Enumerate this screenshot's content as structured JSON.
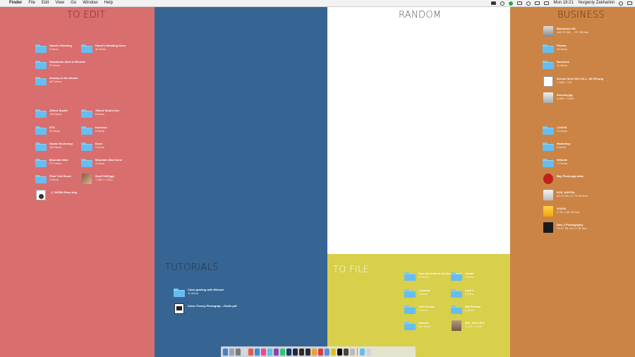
{
  "menubar": {
    "app": "Finder",
    "items": [
      "File",
      "Edit",
      "View",
      "Go",
      "Window",
      "Help"
    ],
    "clock": "Mon 18:21",
    "user": "Yevgeniy Zakharkin"
  },
  "panels": {
    "to_edit": "TO EDIT",
    "tutorials": "TUTORIALS",
    "random": "RANDOM",
    "to_file": "TO FILE",
    "business": "BUSINESS"
  },
  "icons": [
    {
      "name": "David's Wedding",
      "sub": "3 items"
    },
    {
      "name": "David's Wedding Done",
      "sub": "46 items"
    },
    {
      "name": "Headshots Zach & Rhonda",
      "sub": "37 items"
    },
    {
      "name": "Destiny in the Woods",
      "sub": "407 items"
    },
    {
      "name": "JWord Studio",
      "sub": "769 items"
    },
    {
      "name": "JWord Studio Dev",
      "sub": "6 items"
    },
    {
      "name": "STS",
      "sub": "40 items"
    },
    {
      "name": "Holmess",
      "sub": "5 items"
    },
    {
      "name": "Studio Workshop",
      "sub": "163 items"
    },
    {
      "name": "Done",
      "sub": "3 items"
    },
    {
      "name": "Mountain Man",
      "sub": "371 items"
    },
    {
      "name": "Mountain Man Done",
      "sub": "4 items"
    },
    {
      "name": "Final Test Shoot",
      "sub": "2 items"
    },
    {
      "name": "Gozi71195.jpg",
      "sub": "7,360 × 4,912"
    },
    {
      "name": "_Z_DSS50-Pano.dng",
      "sub": ""
    },
    {
      "name": "Color grading with Michael",
      "sub": "11 items"
    },
    {
      "name": "Color-Theory-Photograp....Guide.pdf",
      "sub": ""
    },
    {
      "name": "Paul and Adams 3rd Anniversary",
      "sub": "82 items"
    },
    {
      "name": "Hunter",
      "sub": "4 items"
    },
    {
      "name": "Costume",
      "sub": "2 items"
    },
    {
      "name": "Card 3",
      "sub": "3 items"
    },
    {
      "name": "Test Shoots",
      "sub": "2 items"
    },
    {
      "name": "BW Portrait",
      "sub": "4 items"
    },
    {
      "name": "Roberts",
      "sub": "304 items"
    },
    {
      "name": "IMG_2413.JPG",
      "sub": "3,024 × 4,032"
    },
    {
      "name": "Macintosh HD",
      "sub": "468.75 GB, ... 37 GB free"
    },
    {
      "name": "Photos",
      "sub": "94 items"
    },
    {
      "name": "Business",
      "sub": "11 items"
    },
    {
      "name": "Screen Shot 2017-02-1...58 PM.png",
      "sub": "1,328 × 718"
    },
    {
      "name": "Security.jpg",
      "sub": "3,000 × 4,000"
    },
    {
      "name": "LOGOS",
      "sub": "21 items"
    },
    {
      "name": "Marketing",
      "sub": "4 items"
    },
    {
      "name": "Website",
      "sub": "17 items"
    },
    {
      "name": "Bay Photo.app alias",
      "sub": ""
    },
    {
      "name": "EOS_DIGITAL",
      "sub": "64.01 GB, 57.73 GB free"
    },
    {
      "name": "2018 B",
      "sub": "2 TB, 1.35 TB free"
    },
    {
      "name": "Disc 2 Photography",
      "sub": "75.57 TB, 64.17 TB free"
    }
  ],
  "colors": {
    "to_edit": "#d86e6e",
    "tutorials": "#376593",
    "random": "#ffffff",
    "to_file": "#d8cf4a",
    "business": "#cb8445",
    "folder": "#66bdf0"
  }
}
